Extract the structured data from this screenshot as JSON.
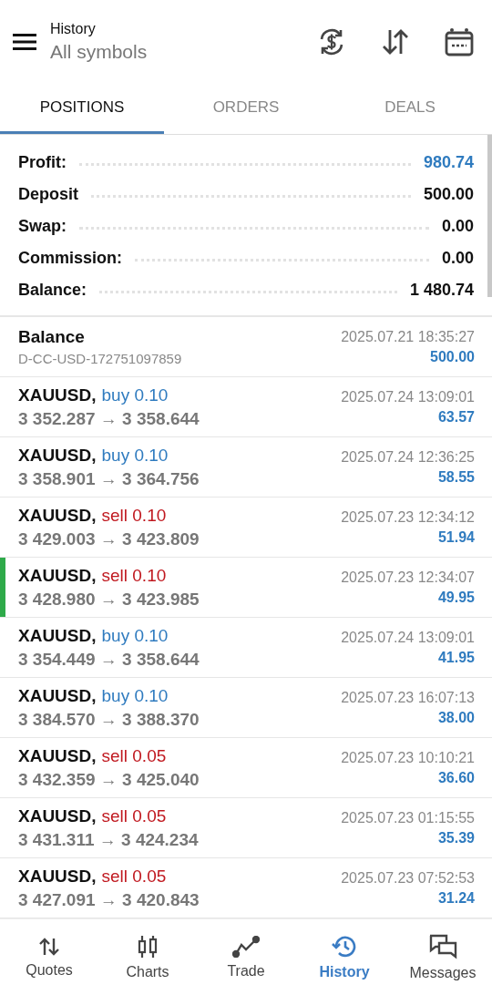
{
  "header": {
    "title": "History",
    "subtitle": "All symbols"
  },
  "tabs": [
    {
      "label": "POSITIONS",
      "selected": true
    },
    {
      "label": "ORDERS",
      "selected": false
    },
    {
      "label": "DEALS",
      "selected": false
    }
  ],
  "summary": [
    {
      "label": "Profit:",
      "value": "980.74",
      "kind": "highlight"
    },
    {
      "label": "Deposit",
      "value": "500.00",
      "kind": "plain"
    },
    {
      "label": "Swap:",
      "value": "0.00",
      "kind": "plain"
    },
    {
      "label": "Commission:",
      "value": "0.00",
      "kind": "plain"
    },
    {
      "label": "Balance:",
      "value": "1 480.74",
      "kind": "plain"
    }
  ],
  "balance_entry": {
    "title": "Balance",
    "comment": "D-CC-USD-172751097859",
    "time": "2025.07.21 18:35:27",
    "amount": "500.00"
  },
  "positions": [
    {
      "symbol": "XAUUSD,",
      "side": "buy",
      "kind": "buy",
      "volume": "0.10",
      "prices": "3 352.287 → 3 358.644",
      "time": "2025.07.24 13:09:01",
      "profit": "63.57",
      "selected": false
    },
    {
      "symbol": "XAUUSD,",
      "side": "buy",
      "kind": "buy",
      "volume": "0.10",
      "prices": "3 358.901 → 3 364.756",
      "time": "2025.07.24 12:36:25",
      "profit": "58.55",
      "selected": false
    },
    {
      "symbol": "XAUUSD,",
      "side": "sell",
      "kind": "sell",
      "volume": "0.10",
      "prices": "3 429.003 → 3 423.809",
      "time": "2025.07.23 12:34:12",
      "profit": "51.94",
      "selected": false
    },
    {
      "symbol": "XAUUSD,",
      "side": "sell",
      "kind": "sell",
      "volume": "0.10",
      "prices": "3 428.980 → 3 423.985",
      "time": "2025.07.23 12:34:07",
      "profit": "49.95",
      "selected": true
    },
    {
      "symbol": "XAUUSD,",
      "side": "buy",
      "kind": "buy",
      "volume": "0.10",
      "prices": "3 354.449 → 3 358.644",
      "time": "2025.07.24 13:09:01",
      "profit": "41.95",
      "selected": false
    },
    {
      "symbol": "XAUUSD,",
      "side": "buy",
      "kind": "buy",
      "volume": "0.10",
      "prices": "3 384.570 → 3 388.370",
      "time": "2025.07.23 16:07:13",
      "profit": "38.00",
      "selected": false
    },
    {
      "symbol": "XAUUSD,",
      "side": "sell",
      "kind": "sell",
      "volume": "0.05",
      "prices": "3 432.359 → 3 425.040",
      "time": "2025.07.23 10:10:21",
      "profit": "36.60",
      "selected": false
    },
    {
      "symbol": "XAUUSD,",
      "side": "sell",
      "kind": "sell",
      "volume": "0.05",
      "prices": "3 431.311 → 3 424.234",
      "time": "2025.07.23 01:15:55",
      "profit": "35.39",
      "selected": false
    },
    {
      "symbol": "XAUUSD,",
      "side": "sell",
      "kind": "sell",
      "volume": "0.05",
      "prices": "3 427.091 → 3 420.843",
      "time": "2025.07.23 07:52:53",
      "profit": "31.24",
      "selected": false
    }
  ],
  "nav": [
    {
      "label": "Quotes",
      "kind": "quotes",
      "selected": false
    },
    {
      "label": "Charts",
      "kind": "charts",
      "selected": false
    },
    {
      "label": "Trade",
      "kind": "trade",
      "selected": false
    },
    {
      "label": "History",
      "kind": "history",
      "selected": true
    },
    {
      "label": "Messages",
      "kind": "messages",
      "selected": false
    }
  ]
}
